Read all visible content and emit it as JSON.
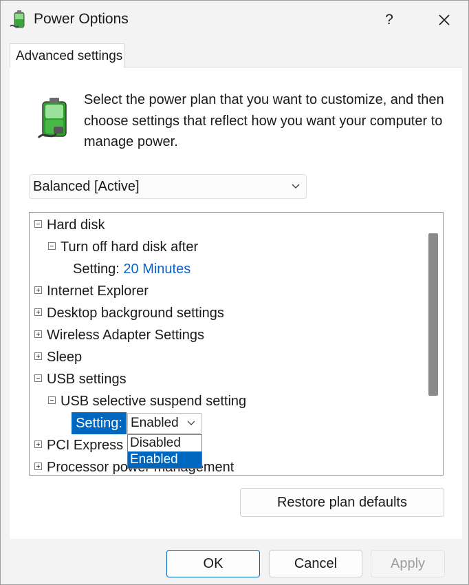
{
  "window": {
    "title": "Power Options",
    "help_label": "?"
  },
  "tab": {
    "label": "Advanced settings"
  },
  "description": "Select the power plan that you want to customize, and then choose settings that reflect how you want your computer to manage power.",
  "plan_select": {
    "value": "Balanced [Active]"
  },
  "tree": {
    "hard_disk": "Hard disk",
    "turn_off_hard_disk": "Turn off hard disk after",
    "hd_setting_label": "Setting:",
    "hd_setting_value": "20 Minutes",
    "internet_explorer": "Internet Explorer",
    "desktop_background": "Desktop background settings",
    "wireless_adapter": "Wireless Adapter Settings",
    "sleep": "Sleep",
    "usb_settings": "USB settings",
    "usb_selective": "USB selective suspend setting",
    "usb_setting_label": "Setting:",
    "usb_setting_value": "Enabled",
    "pci_express": "PCI Express",
    "processor_power": "Processor power management"
  },
  "dropdown": {
    "options": [
      "Disabled",
      "Enabled"
    ],
    "selected": "Enabled"
  },
  "buttons": {
    "restore": "Restore plan defaults",
    "ok": "OK",
    "cancel": "Cancel",
    "apply": "Apply"
  },
  "colors": {
    "accent": "#0067c0",
    "link": "#0b63c8"
  }
}
